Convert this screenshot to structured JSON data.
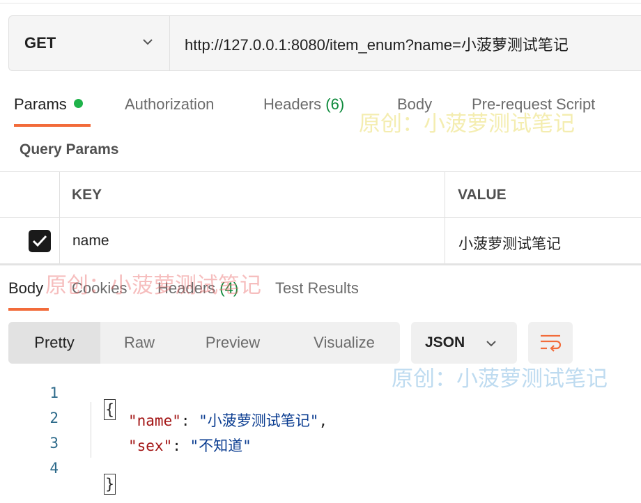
{
  "request": {
    "method": "GET",
    "url": "http://127.0.0.1:8080/item_enum?name=小菠萝测试笔记"
  },
  "request_tabs": {
    "params": "Params",
    "authorization": "Authorization",
    "headers": "Headers",
    "headers_count": "(6)",
    "body": "Body",
    "pre_request": "Pre-request Script"
  },
  "query_params": {
    "title": "Query Params",
    "columns": {
      "key": "KEY",
      "value": "VALUE"
    },
    "rows": [
      {
        "key": "name",
        "value": "小菠萝测试笔记",
        "checked": true
      }
    ]
  },
  "response_tabs": {
    "body": "Body",
    "cookies": "Cookies",
    "headers": "Headers",
    "headers_count": "(4)",
    "test_results": "Test Results"
  },
  "view_modes": {
    "pretty": "Pretty",
    "raw": "Raw",
    "preview": "Preview",
    "visualize": "Visualize",
    "format": "JSON"
  },
  "code_lines": {
    "numbers": [
      "1",
      "2",
      "3",
      "4"
    ],
    "open_brace": "{",
    "close_brace": "}",
    "pairs": [
      {
        "key": "\"name\"",
        "value": "\"小菠萝测试笔记\"",
        "trail": ","
      },
      {
        "key": "\"sex\"",
        "value": "\"不知道\"",
        "trail": ""
      }
    ]
  },
  "watermarks": {
    "w1": "原创：小菠萝测试笔记",
    "w2": "原创：小菠萝测试笔记",
    "w3": "原创：小菠萝测试笔记"
  },
  "colors": {
    "accent": "#f26b3a",
    "status_dot": "#1fb34a",
    "count_green": "#0e8a3c"
  }
}
